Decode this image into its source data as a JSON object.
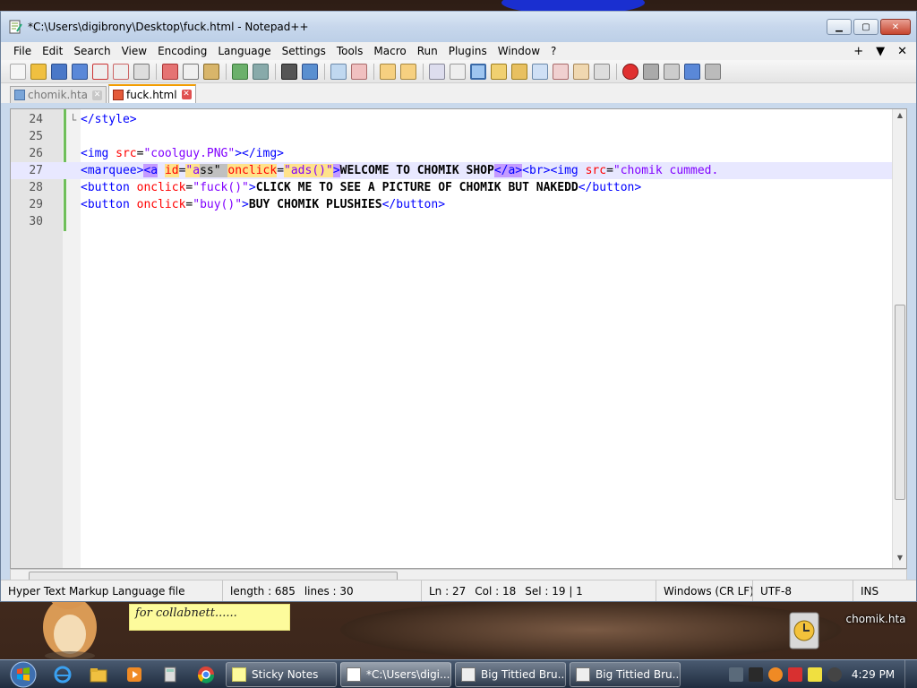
{
  "window": {
    "title": "*C:\\Users\\digibrony\\Desktop\\fuck.html - Notepad++"
  },
  "menu": [
    "File",
    "Edit",
    "Search",
    "View",
    "Encoding",
    "Language",
    "Settings",
    "Tools",
    "Macro",
    "Run",
    "Plugins",
    "Window",
    "?"
  ],
  "menu_right": [
    "+",
    "▼",
    "✕"
  ],
  "tabs": [
    {
      "label": "chomik.hta",
      "active": false
    },
    {
      "label": "fuck.html",
      "active": true
    }
  ],
  "editor": {
    "lines": [
      {
        "num": "24",
        "fold": "└",
        "html_key": "l24"
      },
      {
        "num": "25",
        "fold": "",
        "html_key": "l25"
      },
      {
        "num": "26",
        "fold": "",
        "html_key": "l26"
      },
      {
        "num": "27",
        "fold": "",
        "html_key": "l27"
      },
      {
        "num": "28",
        "fold": "",
        "html_key": "l28"
      },
      {
        "num": "29",
        "fold": "",
        "html_key": "l29"
      },
      {
        "num": "30",
        "fold": "",
        "html_key": "l30"
      }
    ],
    "tokens": {
      "l24": [
        [
          "t-tag",
          "</style>"
        ]
      ],
      "l25": [],
      "l26": [
        [
          "t-tag",
          "<img "
        ],
        [
          "t-attr",
          "src"
        ],
        [
          "code-text",
          "="
        ],
        [
          "t-val",
          "\"coolguy.PNG\""
        ],
        [
          "t-tag",
          "></img>"
        ]
      ],
      "l27": [
        [
          "t-tag",
          "<marquee>"
        ],
        [
          "t-tag-hl",
          "<a"
        ],
        [
          "code-text",
          " "
        ],
        [
          "t-attr-hl",
          "id"
        ],
        [
          "code-text",
          "="
        ],
        [
          "t-val-hl",
          "\"a"
        ],
        [
          "sel",
          "ss\" "
        ],
        [
          "t-attr-hl",
          "onclick"
        ],
        [
          "code-text",
          "="
        ],
        [
          "t-val-hl",
          "\"ads()\""
        ],
        [
          "t-tag-hl",
          ">"
        ],
        [
          "t-txt",
          "WELCOME TO CHOMIK SHOP"
        ],
        [
          "t-tag-hl",
          "</a>"
        ],
        [
          "t-tag",
          "<br><img "
        ],
        [
          "t-attr",
          "src"
        ],
        [
          "code-text",
          "="
        ],
        [
          "t-val",
          "\"chomik cummed."
        ]
      ],
      "l28": [
        [
          "t-tag",
          "<button "
        ],
        [
          "t-attr",
          "onclick"
        ],
        [
          "code-text",
          "="
        ],
        [
          "t-val",
          "\"fuck()\""
        ],
        [
          "t-tag",
          ">"
        ],
        [
          "t-txt",
          "CLICK ME TO SEE A PICTURE OF CHOMIK BUT NAKEDD"
        ],
        [
          "t-tag",
          "</button>"
        ]
      ],
      "l29": [
        [
          "t-tag",
          "<button "
        ],
        [
          "t-attr",
          "onclick"
        ],
        [
          "code-text",
          "="
        ],
        [
          "t-val",
          "\"buy()\""
        ],
        [
          "t-tag",
          ">"
        ],
        [
          "t-txt",
          "BUY CHOMIK PLUSHIES"
        ],
        [
          "t-tag",
          "</button>"
        ]
      ],
      "l30": []
    }
  },
  "status": {
    "filetype": "Hyper Text Markup Language file",
    "length": "length : 685",
    "lines": "lines : 30",
    "ln": "Ln : 27",
    "col": "Col : 18",
    "sel": "Sel : 19 | 1",
    "eol": "Windows (CR LF)",
    "encoding": "UTF-8",
    "mode": "INS"
  },
  "desktop": {
    "sticky_text": "for collabnett......",
    "icon_label": "chomik.hta"
  },
  "taskbar": {
    "tasks": [
      {
        "label": "Sticky Notes",
        "active": false
      },
      {
        "label": "*C:\\Users\\digi...",
        "active": true
      },
      {
        "label": "Big Tittied Bru...",
        "active": false
      },
      {
        "label": "Big Tittied Bru...",
        "active": false
      }
    ],
    "clock": "4:29 PM"
  },
  "colors": {
    "accent": "#f29d00",
    "selection": "#e8e8ff"
  }
}
